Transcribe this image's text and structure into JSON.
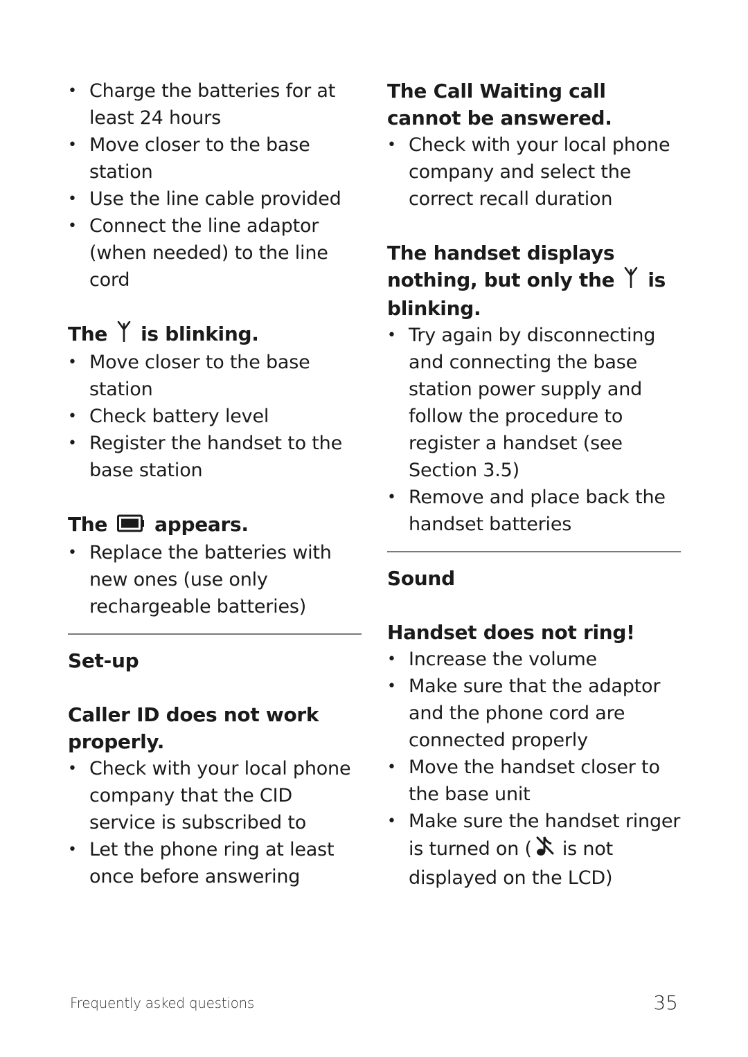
{
  "left_column": {
    "intro_bullets": [
      "Charge the batteries for at least 24 hours",
      "Move closer to the base station",
      "Use the line cable provided",
      "Connect the line adaptor (when needed) to the line cord"
    ],
    "antenna_blinking": {
      "heading_before": "The",
      "icon": "antenna-icon",
      "heading_after": "is blinking.",
      "bullets": [
        "Move closer to the base station",
        "Check battery level",
        "Register the handset to the base station"
      ]
    },
    "battery_appears": {
      "heading_before": "The",
      "icon": "battery-icon",
      "heading_after": "appears.",
      "bullets": [
        "Replace the batteries with new ones (use only rechargeable batteries)"
      ]
    },
    "setup_section": {
      "title": "Set-up",
      "caller_id": {
        "heading": "Caller ID does not work properly.",
        "bullets": [
          "Check with your local phone company that the CID service is subscribed to",
          "Let the phone ring at least once before answering"
        ]
      }
    }
  },
  "right_column": {
    "call_waiting": {
      "heading": "The Call Waiting call cannot be answered.",
      "bullets": [
        "Check with your local phone company and select the correct recall duration"
      ]
    },
    "displays_nothing": {
      "heading_before": "The handset displays nothing, but only the",
      "icon": "antenna-icon",
      "heading_after": "is blinking.",
      "bullets": [
        "Try again by disconnecting and connecting the base station power supply and follow the procedure to register a handset (see Section 3.5)",
        "Remove and place back the handset batteries"
      ]
    },
    "sound_section": {
      "title": "Sound",
      "no_ring": {
        "heading": "Handset does not ring!",
        "bullets": [
          "Increase the volume",
          "Make sure that the adaptor and the phone cord are connected properly",
          "Move the handset closer to the base unit"
        ],
        "ringer_bullet_before": "Make sure the handset ringer is turned on (",
        "ringer_icon": "ringer-off-icon",
        "ringer_bullet_after": "is not displayed on the LCD)"
      }
    }
  },
  "footer": {
    "section_label": "Frequently asked questions",
    "page_number": "35"
  }
}
